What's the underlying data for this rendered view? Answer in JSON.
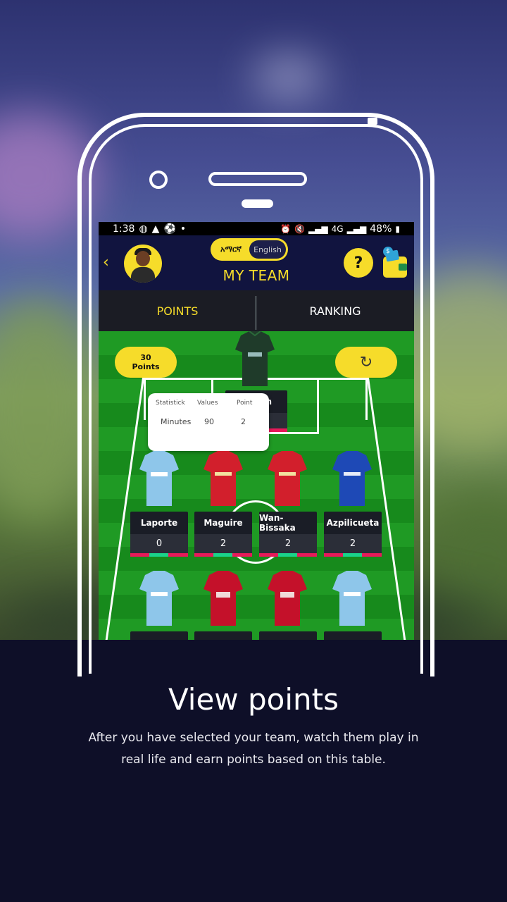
{
  "status_bar": {
    "time": "1:38",
    "left_icons": [
      "whatsapp-icon",
      "drive-icon",
      "soccer-icon",
      "dot-icon"
    ],
    "right_icons": [
      "alarm-icon",
      "mute-icon",
      "signal-icon",
      "4g-icon",
      "signal-icon"
    ],
    "battery": "48%"
  },
  "app_bar": {
    "back": "‹",
    "lang_amharic": "አማርኛ",
    "lang_english": "English",
    "title": "MY TEAM",
    "help": "?",
    "coin": "$"
  },
  "tabs": [
    {
      "label": "POINTS",
      "active": true
    },
    {
      "label": "RANKING",
      "active": false
    }
  ],
  "pitch": {
    "points_value": "30",
    "points_label": "Points",
    "refresh_icon": "↻",
    "goalkeeper_name_fragment": "n",
    "popup": {
      "headers": [
        "Statistick",
        "Values",
        "Point"
      ],
      "row": [
        "Minutes",
        "90",
        "2"
      ]
    },
    "defenders": [
      {
        "name": "Laporte",
        "points": "0",
        "kit": "sky"
      },
      {
        "name": "Maguire",
        "points": "2",
        "kit": "red-united"
      },
      {
        "name": "Wan-Bissaka",
        "points": "2",
        "kit": "red-united"
      },
      {
        "name": "Azpilicueta",
        "points": "2",
        "kit": "blue"
      }
    ],
    "midfielders": [
      {
        "kit": "sky"
      },
      {
        "kit": "red-liverpool"
      },
      {
        "kit": "red-liverpool"
      },
      {
        "kit": "sky"
      }
    ]
  },
  "caption": {
    "title": "View points",
    "text": "After you have selected your team, watch them play in real life and earn points based on this table."
  },
  "colors": {
    "accent": "#f6dc2a",
    "navy": "#11143f",
    "pitch": "#1f9a24"
  }
}
